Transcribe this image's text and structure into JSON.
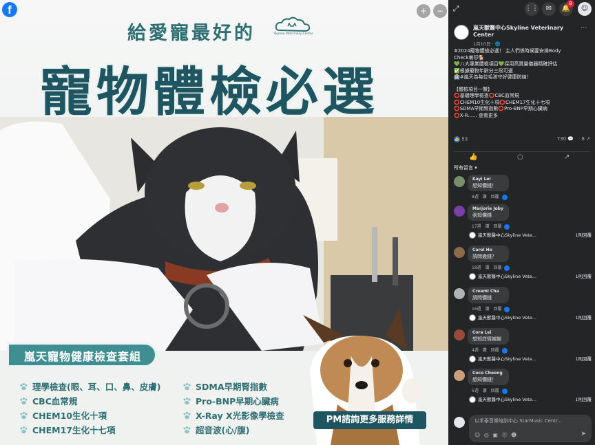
{
  "viewer": {
    "fb_logo": "f",
    "zoom_in_icon": "+",
    "zoom_out_icon": "−",
    "fullscreen_icon": "⤢"
  },
  "poster": {
    "tagline": "給愛寵最好的",
    "brand_name": "Skyline Veterinary Center",
    "headline": "寵物體檢必選",
    "package_title": "嵐天寵物健康檢查套組",
    "services_left": [
      "理學檢查(眼、耳、口、鼻、皮膚)",
      "CBC血常規",
      "CHEM10生化十項",
      "CHEM17生化十七項"
    ],
    "services_right": [
      "SDMA早期腎指數",
      "Pro-BNP早期心臟病",
      "X-Ray X光影像學檢查",
      "超音波(心/腹)"
    ],
    "cta": "PM諮詢更多服務詳情",
    "colors": {
      "teal": "#2f6f73",
      "dark_teal": "#1f5560",
      "pill": "#3f8f92"
    }
  },
  "topbar": {
    "menu_icon": "grid-icon",
    "notif_count": "8"
  },
  "post": {
    "page_name": "嵐天獸醫中心Skyline Veterinary Center",
    "date": "1月10日 · 🌐",
    "more": "···",
    "lines": [
      "#2024寵物體檢必選！ 主人們係時候要安排Body",
      "Check喇🐱🐕",
      "💚八大專業體檢項目💚採用高質量儀器精確評估",
      "✅根據寵物年齡分三段可選",
      "🏥#嵐天為每位毛孩守好健康防線！",
      "",
      "【體檢項目一覽】",
      "⭕基礎理學檢查⭕CBC血常規",
      "⭕CHEM10生化十項⭕CHEM17生化十七項",
      "⭕SDMA早期腎指數⭕Pro-BNP早期心臟病",
      "⭕X-R......  查看更多"
    ],
    "like_count": "53",
    "comment_count": "730 💬",
    "share_count": "8 ↗",
    "sort_label": "所有留言 ▾"
  },
  "comments": [
    {
      "name": "Kayi Lei",
      "text": "想知價錢！",
      "meta": "8週 讚 回覆",
      "reply": "",
      "reply_count": ""
    },
    {
      "name": "Marjorie Joby",
      "text": "張知價錢",
      "meta": "17週 讚 回覆",
      "reply": "嵐天獸醫中心Skyline Vete...",
      "reply_count": "1則回覆"
    },
    {
      "name": "Carol Ho",
      "text": "請問幾錢？",
      "meta": "18週 讚 回覆",
      "reply": "嵐天獸醫中心Skyline Vete...",
      "reply_count": "1則回覆"
    },
    {
      "name": "Creami Cha",
      "text": "請問價錢",
      "meta": "16週 讚 回覆",
      "reply": "嵐天獸醫中心Skyline Vete...",
      "reply_count": "1則回覆"
    },
    {
      "name": "Cora Lei",
      "text": "想知詳情謝謝",
      "meta": "4週 讚 回覆",
      "reply": "嵐天獸醫中心Skyline Vete...",
      "reply_count": "1則回覆"
    },
    {
      "name": "Coco Cheong",
      "text": "想知價錢！",
      "meta": "5週 讚 回覆",
      "reply": "嵐天獸醫中心Skyline Vete...",
      "reply_count": "1則回覆"
    }
  ],
  "composer": {
    "placeholder": "以禾泰音樂培訓中心 StarMusic Centr...",
    "icons": "☺ ◎ ▣ ⓖ ☻",
    "send": "➤"
  }
}
